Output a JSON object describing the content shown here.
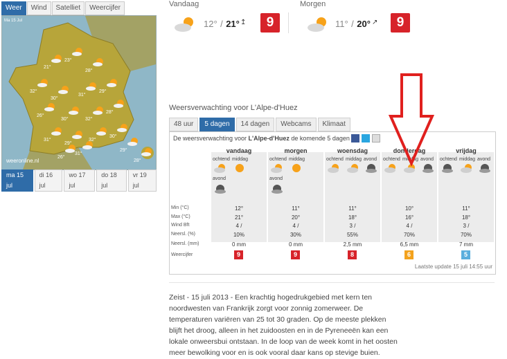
{
  "map_widget": {
    "tabs": [
      "Weer",
      "Wind",
      "Satelliet",
      "Weercijfer"
    ],
    "active_tab": 0,
    "date_label": "Ma 15 Jul",
    "day_tabs": [
      "ma 15 jul",
      "di 16 jul",
      "wo 17 jul",
      "do 18 jul",
      "vr 19 jul"
    ],
    "logo": "weeronline.nl",
    "temps": [
      "21°",
      "23°",
      "28°",
      "32°",
      "30°",
      "31°",
      "29°",
      "26°",
      "30°",
      "32°",
      "28°",
      "31°",
      "29°",
      "32°",
      "30°",
      "26°",
      "31°",
      "29°",
      "28°"
    ],
    "colors": {
      "land": "#b7a53a",
      "sea": "#8fb7c7",
      "active": "#2f6ca8"
    }
  },
  "today": {
    "label": "Vandaag",
    "min": "12°",
    "sep": "/",
    "max": "21°",
    "score": "9"
  },
  "tomorrow": {
    "label": "Morgen",
    "min": "11°",
    "sep": "/",
    "max": "20°",
    "score": "9"
  },
  "section": {
    "title": "Weersverwachting voor L'Alpe-d'Huez",
    "tabs": [
      "48 uur",
      "5 dagen",
      "14 dagen",
      "Webcams",
      "Klimaat"
    ],
    "active_tab": 1,
    "intro_prefix": "De weersverwachting voor ",
    "intro_place": "L'Alpe-d'Huez",
    "intro_suffix": " de komende 5 dagen"
  },
  "forecast": {
    "sub_labels": {
      "morning": "ochtend",
      "noon": "middag",
      "evening": "avond"
    },
    "row_labels": {
      "min": "Min (°C)",
      "max": "Max (°C)",
      "wind": "Wind Bft",
      "precip_pct": "Neersl. (%)",
      "precip_mm": "Neersl. (mm)",
      "score": "Weercijfer"
    },
    "days": [
      {
        "name": "vandaag",
        "min": "12°",
        "max": "21°",
        "wind": "4 /",
        "precip_pct": "10%",
        "precip_mm": "0 mm",
        "score": "9",
        "score_color": "#d7232a"
      },
      {
        "name": "morgen",
        "min": "11°",
        "max": "20°",
        "wind": "4 /",
        "precip_pct": "30%",
        "precip_mm": "0 mm",
        "score": "9",
        "score_color": "#d7232a"
      },
      {
        "name": "woensdag",
        "min": "11°",
        "max": "18°",
        "wind": "3 /",
        "precip_pct": "55%",
        "precip_mm": "2,5 mm",
        "score": "8",
        "score_color": "#d7232a"
      },
      {
        "name": "donderdag",
        "min": "10°",
        "max": "16°",
        "wind": "4 /",
        "precip_pct": "70%",
        "precip_mm": "6,5 mm",
        "score": "6",
        "score_color": "#f3a21d"
      },
      {
        "name": "vrijdag",
        "min": "11°",
        "max": "18°",
        "wind": "3 /",
        "precip_pct": "70%",
        "precip_mm": "7 mm",
        "score": "5",
        "score_color": "#5aaedd"
      }
    ],
    "updated": "Laatste update 15 juli 14:55 uur"
  },
  "article": "Zeist - 15 juli 2013 - Een krachtig hogedrukgebied met kern ten noordwesten van Frankrijk zorgt voor zonnig zomerweer. De temperaturen variëren van 25 tot 30 graden. Op de meeste plekken blijft het droog, alleen in het zuidoosten en in de Pyreneeën kan een lokale onweersbui ontstaan. In de loop van de week komt in het oosten meer bewolking voor en is ook vooral daar kans op stevige buien.",
  "annotation": {
    "color": "#e0201e"
  }
}
